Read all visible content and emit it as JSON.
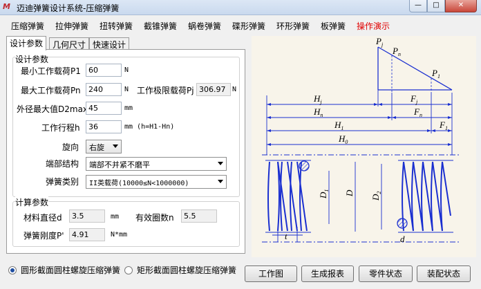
{
  "window": {
    "title": "迈迪弹簧设计系统-压缩弹簧",
    "icon_text": "M",
    "controls": [
      "minimize-icon",
      "maximize-icon",
      "close-icon"
    ]
  },
  "menu": [
    "压缩弹簧",
    "拉伸弹簧",
    "扭转弹簧",
    "截锥弹簧",
    "蜗卷弹簧",
    "碟形弹簧",
    "环形弹簧",
    "板弹簧",
    "操作演示"
  ],
  "tabs": [
    "设计参数",
    "几何尺寸",
    "快速设计"
  ],
  "design": {
    "title": "设计参数",
    "min_load_label": "最小工作载荷P1",
    "min_load_value": "60",
    "min_load_unit": "N",
    "max_load_label": "最大工作载荷Pn",
    "max_load_value": "240",
    "max_load_unit": "N",
    "limit_load_label": "工作极限载荷Pj",
    "limit_load_value": "306.97",
    "limit_load_unit": "N",
    "outer_dia_label": "外径最大值D2max",
    "outer_dia_value": "45",
    "outer_dia_unit": "mm",
    "stroke_label": "工作行程h",
    "stroke_value": "36",
    "stroke_unit": "mm (h=H1-Hn)",
    "rotation_label": "旋向",
    "rotation_value": "右旋",
    "end_label": "端部结构",
    "end_value": "端部不并紧不磨平",
    "class_label": "弹簧类别",
    "class_value": "II类载荷(10000≤N<1000000)"
  },
  "calc": {
    "title": "计算参数",
    "wire_label": "材料直径d",
    "wire_value": "3.5",
    "wire_unit": "mm",
    "coils_label": "有效圈数n",
    "coils_value": "5.5",
    "stiff_label": "弹簧刚度P'",
    "stiff_value": "4.91",
    "stiff_unit": "N*mm"
  },
  "diagram_labels": {
    "pj": "P",
    "pj_sub": "j",
    "pn": "P",
    "pn_sub": "n",
    "p1": "P",
    "p1_sub": "1",
    "hj": "H",
    "hj_sub": "j",
    "hn": "H",
    "hn_sub": "n",
    "h1": "H",
    "h1_sub": "1",
    "h0": "H",
    "h0_sub": "0",
    "fj": "F",
    "fj_sub": "j",
    "fn": "F",
    "fn_sub": "n",
    "f1": "F",
    "f1_sub": "1",
    "d1": "D",
    "d1_sub": "1",
    "d": "D",
    "d2": "D",
    "d2_sub": "2",
    "t": "t",
    "dw": "d"
  },
  "section_type": {
    "round": "圆形截面圆柱螺旋压缩弹簧",
    "rect": "矩形截面圆柱螺旋压缩弹簧",
    "selected": "round"
  },
  "buttons": [
    "工作图",
    "生成报表",
    "零件状态",
    "装配状态"
  ],
  "colors": {
    "menu_active": "#e00000",
    "spring": "#1a2fd0",
    "hatch": "#1a2fd0",
    "diagram_bg": "#f8f4ea"
  }
}
